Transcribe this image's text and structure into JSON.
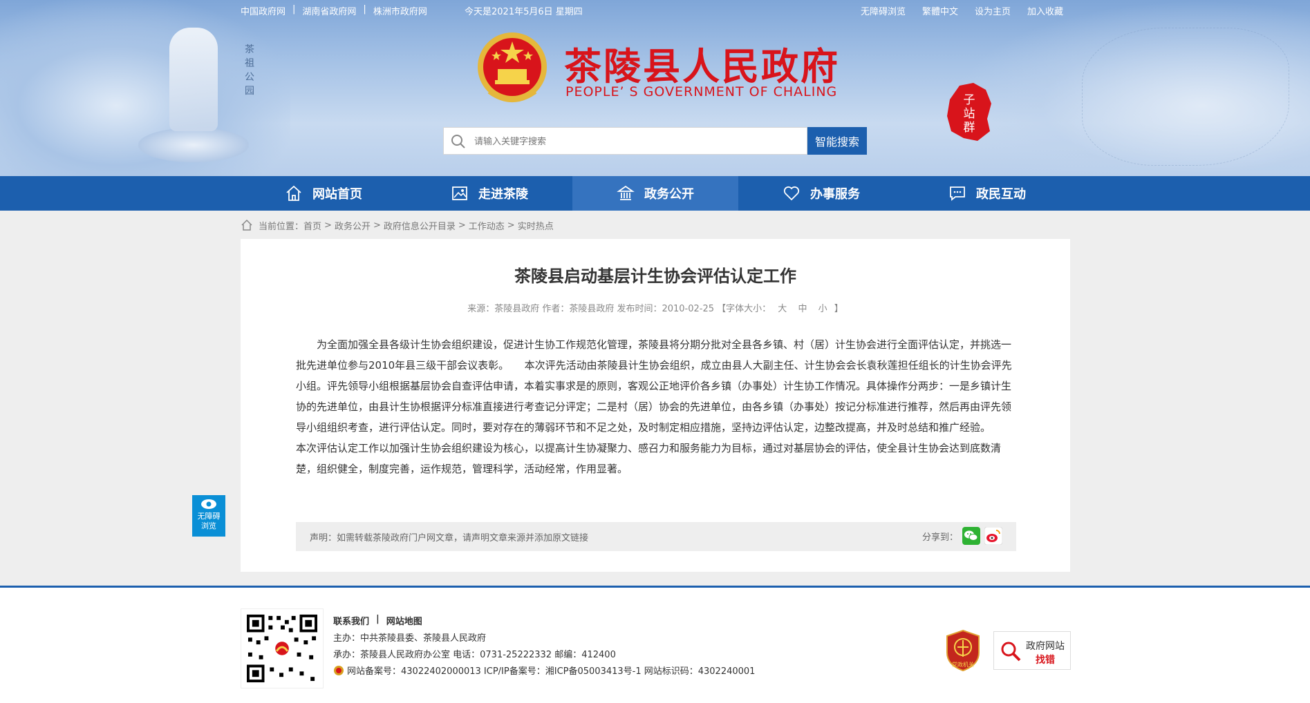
{
  "topbar": {
    "links_left": [
      "中国政府网",
      "湖南省政府网",
      "株洲市政府网"
    ],
    "date": "今天是2021年5月6日 星期四",
    "links_right": [
      "无障碍浏览",
      "繁體中文",
      "设为主页",
      "加入收藏"
    ]
  },
  "header": {
    "park_text": "茶祖公园",
    "title": "茶陵县人民政府",
    "subtitle": "PEOPLE’ S GOVERNMENT OF CHALING",
    "subsite_label": "子站群"
  },
  "search": {
    "placeholder": "请输入关键字搜索",
    "button": "智能搜索"
  },
  "nav": {
    "items": [
      {
        "label": "网站首页",
        "icon": "home-icon"
      },
      {
        "label": "走进茶陵",
        "icon": "picture-icon"
      },
      {
        "label": "政务公开",
        "icon": "government-icon"
      },
      {
        "label": "办事服务",
        "icon": "heart-icon"
      },
      {
        "label": "政民互动",
        "icon": "chat-icon"
      }
    ],
    "active_index": 2
  },
  "breadcrumb": {
    "prefix": "当前位置：",
    "items": [
      "首页",
      "政务公开",
      "政府信息公开目录",
      "工作动态",
      "实时热点"
    ]
  },
  "article": {
    "title": "茶陵县启动基层计生协会评估认定工作",
    "meta": "来源：茶陵县政府 作者：茶陵县政府 发布时间：2010-02-25 【字体大小：",
    "font_large": "大",
    "font_medium": "中",
    "font_small": "小",
    "meta_end": "】",
    "body": "为全面加强全县各级计生协会组织建设，促进计生协工作规范化管理，茶陵县将分期分批对全县各乡镇、村（居）计生协会进行全面评估认定，并挑选一批先进单位参与2010年县三级干部会议表彰。　　本次评先活动由茶陵县计生协会组织，成立由县人大副主任、计生协会会长袁秋莲担任组长的计生协会评先小组。评先领导小组根据基层协会自查评估申请，本着实事求是的原则，客观公正地评价各乡镇（办事处）计生协工作情况。具体操作分两步：一是乡镇计生协的先进单位，由县计生协根据评分标准直接进行考查记分评定；二是村（居）协会的先进单位，由各乡镇（办事处）按记分标准进行推荐，然后再由评先领导小组组织考查，进行评估认定。同时，要对存在的薄弱环节和不足之处，及时制定相应措施，坚持边评估认定，边整改提高，并及时总结和推广经验。　　本次评估认定工作以加强计生协会组织建设为核心，以提高计生协凝聚力、感召力和服务能力为目标，通过对基层协会的评估，使全县计生协会达到底数清楚，组织健全，制度完善，运作规范，管理科学，活动经常，作用显著。",
    "declare": "声明：如需转载茶陵政府门户网文章，请声明文章来源并添加原文链接",
    "share_label": "分享到："
  },
  "access_float": {
    "line1": "无障碍",
    "line2": "浏览"
  },
  "footer": {
    "links": [
      "联系我们",
      "网站地图"
    ],
    "host": "主办：中共茶陵县委、茶陵县人民政府",
    "organizer": "承办：茶陵县人民政府办公室 电话：0731-25222332 邮编：412400",
    "beian": "网站备案号：43022402000013 ICP/IP备案号：湘ICP备05003413号-1 网站标识码：4302240001",
    "party_badge": "党政机关",
    "jiucuo_line1": "政府网站",
    "jiucuo_line2": "找错"
  },
  "colors": {
    "primary": "#1c5fae",
    "nav_active": "#3573bf",
    "title_red": "#d8141b",
    "access_blue": "#0a8fd6"
  }
}
